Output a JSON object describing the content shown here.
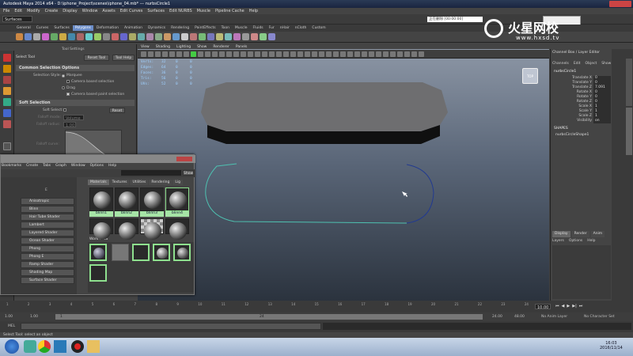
{
  "window": {
    "title": "Autodesk Maya 2014 x64 - D:\\iphone_Project\\scenes\\iphone_04.mb* --- nurbsCircle1"
  },
  "menubar": [
    "File",
    "Edit",
    "Modify",
    "Create",
    "Display",
    "Window",
    "Assets",
    "Edit Curves",
    "Surfaces",
    "Edit NURBS",
    "Muscle",
    "Pipeline Cache",
    "Help"
  ],
  "statusline": {
    "mode": "Surfaces",
    "ime": "正在删除 [00:00:00]"
  },
  "shelf_tabs": [
    "General",
    "Curves",
    "Surfaces",
    "Polygons",
    "Deformation",
    "Animation",
    "Dynamics",
    "Rendering",
    "PaintEffects",
    "Toon",
    "Muscle",
    "Fluids",
    "Fur",
    "nHair",
    "nCloth",
    "Custom"
  ],
  "shelf_active": "Polygons",
  "tool_settings": {
    "header": "Tool Settings",
    "tool_name": "Select Tool",
    "reset_button": "Reset Tool",
    "help_button": "Tool Help",
    "common_section": "Common Selection Options",
    "selection_style_label": "Selection Style:",
    "marquee": "Marquee",
    "camera_based": "Camera based selection",
    "drag": "Drag",
    "camera_paint": "Camera based paint selection",
    "soft_section": "Soft Selection",
    "soft_select_label": "Soft Select:",
    "soft_reset": "Reset",
    "falloff_mode_label": "Falloff mode:",
    "falloff_mode_value": "Volume",
    "falloff_radius_label": "Falloff radius:",
    "falloff_radius_value": "1.00",
    "falloff_curve_label": "Falloff curve:"
  },
  "viewport": {
    "menu": [
      "View",
      "Shading",
      "Lighting",
      "Show",
      "Renderer",
      "Panels"
    ],
    "hud": [
      {
        "label": "Verts:",
        "a": "32",
        "b": "0",
        "c": "0"
      },
      {
        "label": "Edges:",
        "a": "64",
        "b": "0",
        "c": "0"
      },
      {
        "label": "Faces:",
        "a": "36",
        "b": "0",
        "c": "0"
      },
      {
        "label": "Tris:",
        "a": "56",
        "b": "0",
        "c": "0"
      },
      {
        "label": "UVs:",
        "a": "52",
        "b": "0",
        "c": "0"
      }
    ],
    "viewcube": "TOP"
  },
  "hypershade": {
    "menu": [
      "Bookmarks",
      "Create",
      "Tabs",
      "Graph",
      "Window",
      "Options",
      "Help"
    ],
    "show_button": "Show",
    "tabs": [
      "Materials",
      "Textures",
      "Utilities",
      "Rendering",
      "Lig"
    ],
    "active_tab": "Materials",
    "create_list": [
      "Anisotropic",
      "Blinn",
      "Hair Tube Shader",
      "Lambert",
      "Layered Shader",
      "Ocean Shader",
      "Phong",
      "Phong E",
      "Ramp Shader",
      "Shading Map",
      "Surface Shader"
    ],
    "materials": [
      "blinn1",
      "blinn2",
      "blinn3",
      "blinn4"
    ],
    "work_area": "Work Area"
  },
  "channel_box": {
    "header": "Channel Box / Layer Editor",
    "menu": [
      "Channels",
      "Edit",
      "Object",
      "Show"
    ],
    "object": "nurbsCircle1",
    "channels": [
      {
        "name": "Translate X",
        "value": "0"
      },
      {
        "name": "Translate Y",
        "value": "0"
      },
      {
        "name": "Translate Z",
        "value": "7.091"
      },
      {
        "name": "Rotate X",
        "value": "0"
      },
      {
        "name": "Rotate Y",
        "value": "0"
      },
      {
        "name": "Rotate Z",
        "value": "0"
      },
      {
        "name": "Scale X",
        "value": "1"
      },
      {
        "name": "Scale Y",
        "value": "1"
      },
      {
        "name": "Scale Z",
        "value": "1"
      },
      {
        "name": "Visibility",
        "value": "on"
      }
    ],
    "shapes_label": "SHAPES",
    "shape_name": "nurbsCircleShape1",
    "layer_tabs": [
      "Display",
      "Render",
      "Anim"
    ],
    "layer_menu": [
      "Layers",
      "Options",
      "Help"
    ]
  },
  "timeline": {
    "ticks": [
      "1",
      "2",
      "3",
      "4",
      "5",
      "6",
      "7",
      "8",
      "9",
      "10",
      "11",
      "12",
      "13",
      "14",
      "15",
      "16",
      "17",
      "18",
      "19",
      "20",
      "21",
      "22",
      "23",
      "24"
    ],
    "current_frame": "10.00"
  },
  "range": {
    "start": "1.00",
    "start2": "1.00",
    "range_mid": "1",
    "range_end_marker": "24",
    "end": "24.00",
    "end2": "48.00",
    "anim_layer": "No Anim Layer",
    "char_set": "No Character Set"
  },
  "mel": {
    "label": "MEL"
  },
  "help_line": "Select Tool: select an object",
  "taskbar": {
    "time": "16:03",
    "date": "2016/11/14"
  },
  "watermark": {
    "brand": "火星网校",
    "url": "www.hxsd.tv"
  }
}
